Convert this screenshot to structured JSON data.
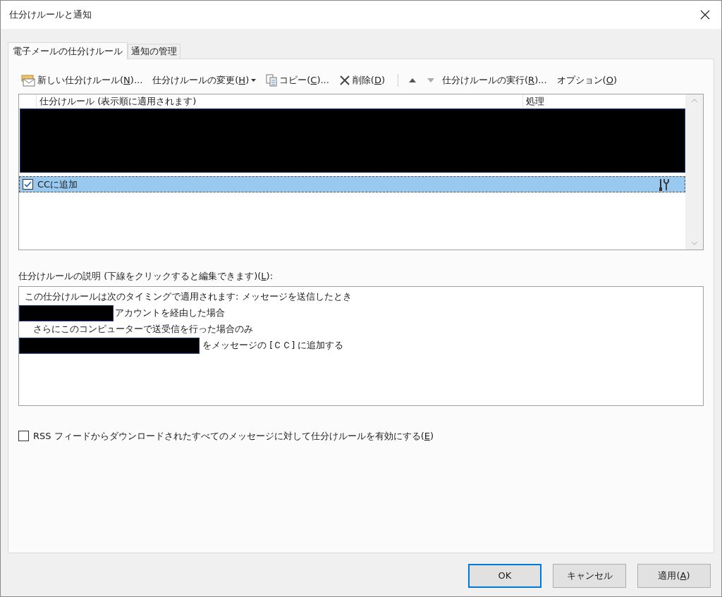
{
  "window": {
    "title": "仕分けルールと通知"
  },
  "tabs": [
    {
      "label": "電子メールの仕分けルール",
      "selected": true
    },
    {
      "label": "通知の管理",
      "selected": false
    }
  ],
  "toolbar": [
    {
      "kind": "new",
      "before": "新しい仕分けルール(",
      "key": "N",
      "after": ")..."
    },
    {
      "kind": "menu",
      "before": "仕分けルールの変更(",
      "key": "H",
      "after": ")"
    },
    {
      "kind": "copy",
      "before": "コピー(",
      "key": "C",
      "after": ")..."
    },
    {
      "kind": "delete",
      "before": "削除(",
      "key": "D",
      "after": ")"
    },
    {
      "kind": "separator"
    },
    {
      "kind": "up"
    },
    {
      "kind": "down"
    },
    {
      "kind": "plain",
      "before": "仕分けルールの実行(",
      "key": "R",
      "after": ")..."
    },
    {
      "kind": "plain",
      "before": "オプション(",
      "key": "O",
      "after": ")"
    }
  ],
  "rules_list": {
    "columns": [
      "仕分けルール (表示順に適用されます)",
      "処理"
    ],
    "rows": [
      {
        "kind": "redacted"
      },
      {
        "kind": "rule",
        "name": "CCに追加",
        "checked": true,
        "selected": true
      }
    ]
  },
  "description": {
    "before": "仕分けルールの説明 (下線をクリックすると編集できます)(",
    "key": "L",
    "after": "):",
    "lines": [
      {
        "kind": "text",
        "text": "この仕分けルールは次のタイミングで適用されます: メッセージを送信したとき"
      },
      {
        "kind": "redacted_short",
        "text": "アカウントを経由した場合"
      },
      {
        "kind": "indent",
        "text": "さらにこのコンピューターで送受信を行った場合のみ"
      },
      {
        "kind": "redacted_long",
        "text": "をメッセージの [ＣＣ] に追加する"
      }
    ]
  },
  "rss_checkbox": {
    "before": "RSS フィードからダウンロードされたすべてのメッセージに対して仕分けルールを有効にする(",
    "key": "E",
    "after": ")",
    "checked": false
  },
  "buttons": [
    {
      "before": "OK",
      "default": true
    },
    {
      "before": "キャンセル",
      "default": false
    },
    {
      "before": "適用(",
      "key": "A",
      "after": ")",
      "default": false
    }
  ]
}
